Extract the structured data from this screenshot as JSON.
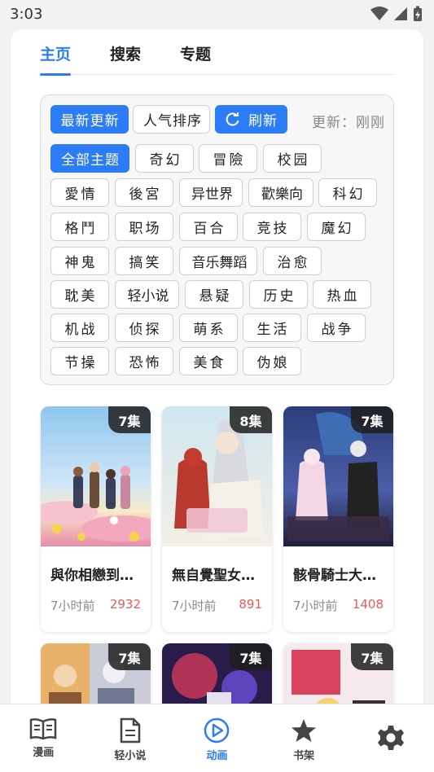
{
  "status_bar": {
    "time": "3:03"
  },
  "tabs": [
    {
      "label": "主页",
      "active": true
    },
    {
      "label": "搜索",
      "active": false
    },
    {
      "label": "专题",
      "active": false
    }
  ],
  "filters": {
    "sort_latest": "最新更新",
    "sort_popular": "人气排序",
    "refresh": "刷新",
    "update_status": "更新：刚刚",
    "all_topics": "全部主题",
    "topics": [
      "奇幻",
      "冒險",
      "校园",
      "愛情",
      "後宮",
      "异世界",
      "歡樂向",
      "科幻",
      "格鬥",
      "职场",
      "百合",
      "竞技",
      "魔幻",
      "神鬼",
      "搞笑",
      "音乐舞蹈",
      "治愈",
      "耽美",
      "轻小说",
      "悬疑",
      "历史",
      "热血",
      "机战",
      "侦探",
      "萌系",
      "生活",
      "战争",
      "节操",
      "恐怖",
      "美食",
      "伪娘"
    ]
  },
  "anime": [
    {
      "title": "與你相戀到天國",
      "episodes": "7集",
      "time": "7小时前",
      "count": "2932"
    },
    {
      "title": "無自覺聖女依舊",
      "episodes": "8集",
      "time": "7小时前",
      "count": "891"
    },
    {
      "title": "骸骨騎士大人異世界冒險中",
      "episodes": "7集",
      "time": "7小时前",
      "count": "1408"
    },
    {
      "title": "",
      "episodes": "7集",
      "time": "",
      "count": ""
    },
    {
      "title": "",
      "episodes": "7集",
      "time": "",
      "count": ""
    },
    {
      "title": "",
      "episodes": "7集",
      "time": "",
      "count": ""
    }
  ],
  "bottom_nav": [
    {
      "label": "漫画",
      "icon": "book-icon"
    },
    {
      "label": "轻小说",
      "icon": "document-icon"
    },
    {
      "label": "动画",
      "icon": "play-icon",
      "active": true
    },
    {
      "label": "书架",
      "icon": "star-icon"
    },
    {
      "label": "",
      "icon": "gear-icon"
    }
  ],
  "colors": {
    "accent": "#2b7cf6",
    "count": "#e9595a"
  }
}
